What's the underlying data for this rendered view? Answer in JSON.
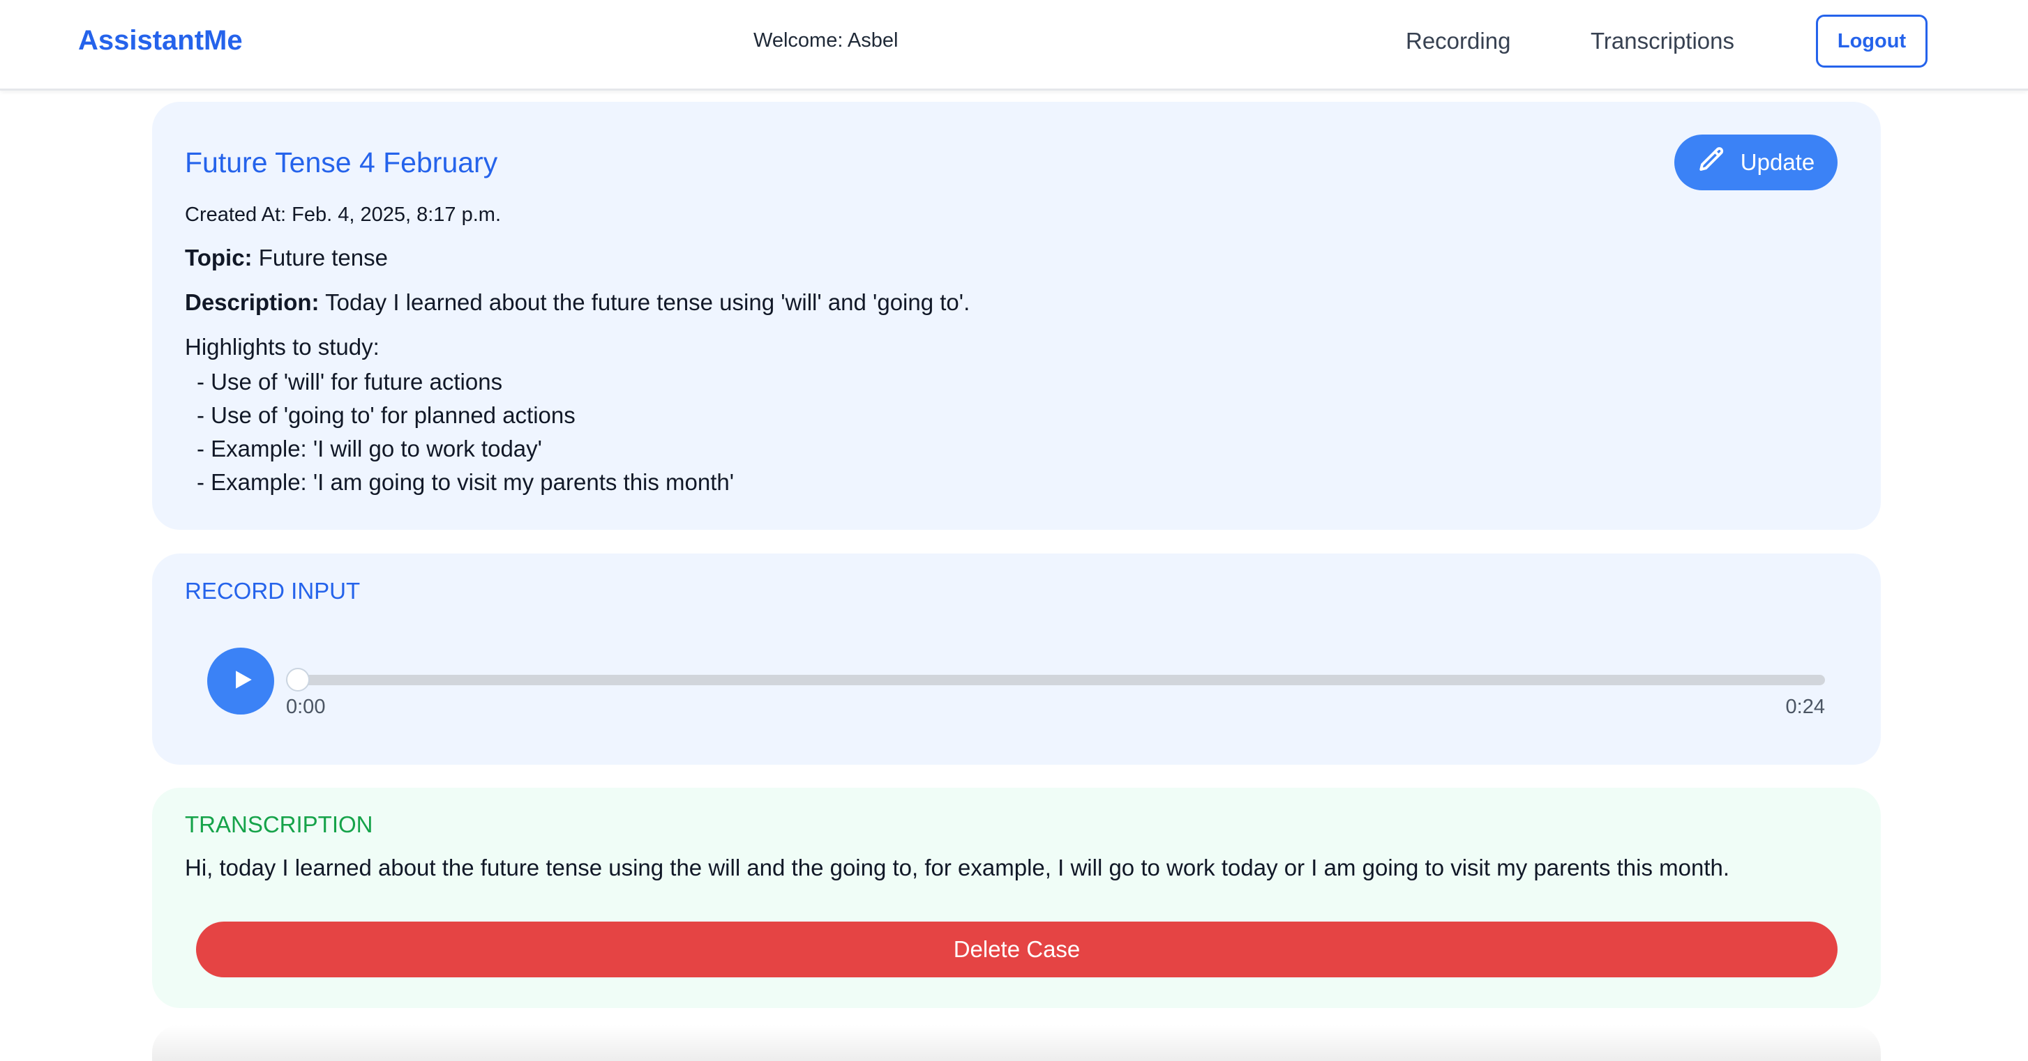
{
  "navbar": {
    "brand": "AssistantMe",
    "welcome": "Welcome: Asbel",
    "links": [
      "Recording",
      "Transcriptions"
    ],
    "logout_label": "Logout"
  },
  "case": {
    "title": "Future Tense 4 February",
    "update_label": "Update",
    "created_at": "Created At: Feb. 4, 2025, 8:17 p.m.",
    "topic_label": "Topic:",
    "topic": "Future tense",
    "description_label": "Description:",
    "description": "Today I learned about the future tense using 'will' and 'going to'.",
    "highlights_label": "Highlights to study:",
    "highlights": [
      "- Use of 'will' for future actions",
      "- Use of 'going to' for planned actions",
      "- Example: 'I will go to work today'",
      "- Example: 'I am going to visit my parents this month'"
    ]
  },
  "record": {
    "label": "RECORD INPUT",
    "current_time": "0:00",
    "total_time": "0:24",
    "progress": 0
  },
  "transcription": {
    "label": "TRANSCRIPTION",
    "text": "Hi, today I learned about the future tense using the will and the going to, for example, I will go to work today or I am going to visit my parents this month.",
    "delete_label": "Delete Case"
  },
  "colors": {
    "primary": "#2563eb",
    "button_blue": "#3b82f6",
    "green": "#16a34a",
    "danger": "#e54444"
  },
  "icons": {
    "update": "pencil-icon",
    "play": "play-icon"
  }
}
